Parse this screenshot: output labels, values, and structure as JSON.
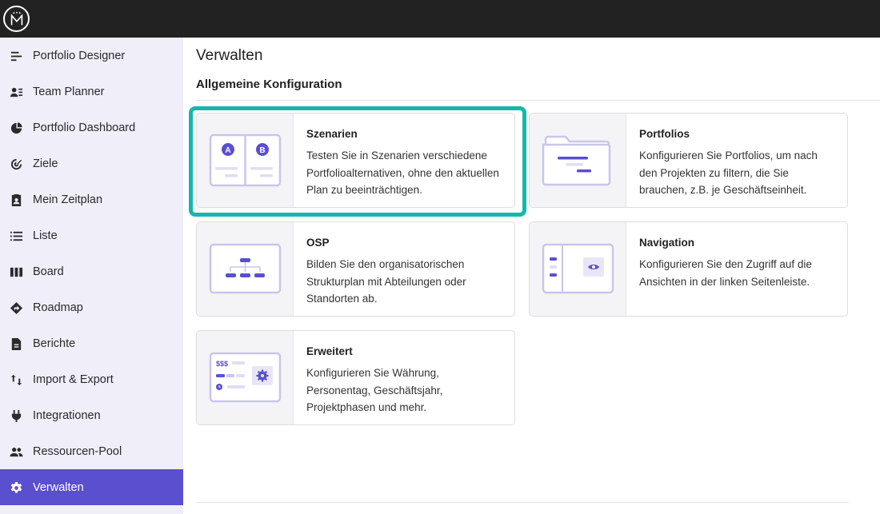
{
  "app": {
    "logo_icon": "meisterplan-logo-icon"
  },
  "sidebar": {
    "items": [
      {
        "label": "Portfolio Designer",
        "icon": "portfolio-designer-icon"
      },
      {
        "label": "Team Planner",
        "icon": "team-planner-icon"
      },
      {
        "label": "Portfolio Dashboard",
        "icon": "dashboard-icon"
      },
      {
        "label": "Ziele",
        "icon": "target-icon"
      },
      {
        "label": "Mein Zeitplan",
        "icon": "badge-icon"
      },
      {
        "label": "Liste",
        "icon": "list-icon"
      },
      {
        "label": "Board",
        "icon": "board-icon"
      },
      {
        "label": "Roadmap",
        "icon": "roadmap-icon"
      },
      {
        "label": "Berichte",
        "icon": "report-icon"
      },
      {
        "label": "Import & Export",
        "icon": "import-export-icon"
      },
      {
        "label": "Integrationen",
        "icon": "plug-icon"
      },
      {
        "label": "Ressourcen-Pool",
        "icon": "people-icon"
      },
      {
        "label": "Verwalten",
        "icon": "gear-icon",
        "active": true
      }
    ]
  },
  "main": {
    "title": "Verwalten",
    "section": "Allgemeine Konfiguration",
    "cards": [
      {
        "title": "Szenarien",
        "desc": "Testen Sie in Szenarien verschiedene Portfolioalternativen, ohne den aktuellen Plan zu beeinträchtigen.",
        "highlighted": true
      },
      {
        "title": "Portfolios",
        "desc": "Konfigurieren Sie Portfolios, um nach den Projekten zu filtern, die Sie brauchen, z.B. je Geschäftseinheit."
      },
      {
        "title": "OSP",
        "desc": "Bilden Sie den organisatorischen Strukturplan mit Abteilungen oder Standorten ab."
      },
      {
        "title": "Navigation",
        "desc": "Konfigurieren Sie den Zugriff auf die Ansichten in der linken Seitenleiste."
      },
      {
        "title": "Erweitert",
        "desc": "Konfigurieren Sie Währung, Personentag, Geschäftsjahr, Projektphasen und mehr."
      }
    ],
    "illustrations": {
      "scenario_a": "A",
      "scenario_b": "B",
      "currency": "$$$"
    }
  },
  "colors": {
    "accent": "#5a4fcf",
    "highlight": "#14b8aa",
    "topbar": "#222222",
    "sidebar_bg": "#f0eef9"
  }
}
